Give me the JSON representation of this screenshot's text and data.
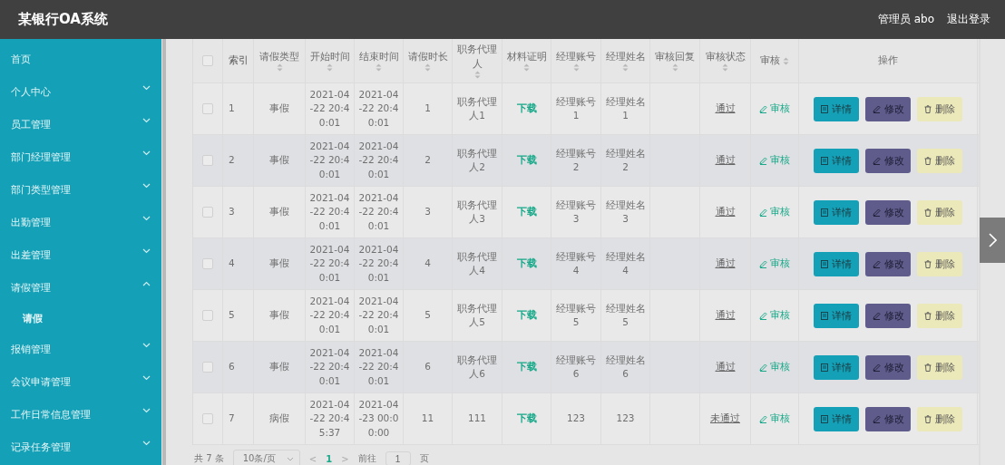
{
  "header": {
    "title": "某银行OA系统",
    "user": "管理员 abo",
    "logout": "退出登录"
  },
  "sidebar": {
    "items": [
      {
        "label": "首页"
      },
      {
        "label": "个人中心",
        "expanded": false
      },
      {
        "label": "员工管理",
        "expanded": false
      },
      {
        "label": "部门经理管理",
        "expanded": false
      },
      {
        "label": "部门类型管理",
        "expanded": false
      },
      {
        "label": "出勤管理",
        "expanded": false
      },
      {
        "label": "出差管理",
        "expanded": false
      },
      {
        "label": "请假管理",
        "expanded": true,
        "children": [
          {
            "label": "请假"
          }
        ]
      },
      {
        "label": "报销管理",
        "expanded": false
      },
      {
        "label": "会议申请管理",
        "expanded": false
      },
      {
        "label": "工作日常信息管理",
        "expanded": false
      },
      {
        "label": "记录任务管理",
        "expanded": false
      }
    ]
  },
  "table": {
    "select_all_checked": false,
    "columns": [
      {
        "label": "索引",
        "sortable": false
      },
      {
        "label": "请假类型",
        "sortable": true
      },
      {
        "label": "开始时间",
        "sortable": true
      },
      {
        "label": "结束时间",
        "sortable": true
      },
      {
        "label": "请假时长",
        "sortable": true
      },
      {
        "label": "职务代理人",
        "sortable": true
      },
      {
        "label": "材料证明",
        "sortable": true
      },
      {
        "label": "经理账号",
        "sortable": true
      },
      {
        "label": "经理姓名",
        "sortable": true
      },
      {
        "label": "审核回复",
        "sortable": true
      },
      {
        "label": "审核状态",
        "sortable": true
      },
      {
        "label": "审核",
        "sortable": true
      },
      {
        "label": "操作",
        "sortable": false
      }
    ],
    "rows": [
      {
        "checked": false,
        "cells": [
          "1",
          "事假",
          "2021-04-22 20:40:01",
          "2021-04-22 20:40:01",
          "1",
          "职务代理人1",
          "下载",
          "经理账号1",
          "经理姓名1",
          "",
          "通过",
          "审核"
        ],
        "actions": [
          "详情",
          "修改",
          "删除"
        ]
      },
      {
        "checked": false,
        "cells": [
          "2",
          "事假",
          "2021-04-22 20:40:01",
          "2021-04-22 20:40:01",
          "2",
          "职务代理人2",
          "下载",
          "经理账号2",
          "经理姓名2",
          "",
          "通过",
          "审核"
        ],
        "actions": [
          "详情",
          "修改",
          "删除"
        ]
      },
      {
        "checked": false,
        "cells": [
          "3",
          "事假",
          "2021-04-22 20:40:01",
          "2021-04-22 20:40:01",
          "3",
          "职务代理人3",
          "下载",
          "经理账号3",
          "经理姓名3",
          "",
          "通过",
          "审核"
        ],
        "actions": [
          "详情",
          "修改",
          "删除"
        ]
      },
      {
        "checked": false,
        "cells": [
          "4",
          "事假",
          "2021-04-22 20:40:01",
          "2021-04-22 20:40:01",
          "4",
          "职务代理人4",
          "下载",
          "经理账号4",
          "经理姓名4",
          "",
          "通过",
          "审核"
        ],
        "actions": [
          "详情",
          "修改",
          "删除"
        ]
      },
      {
        "checked": false,
        "cells": [
          "5",
          "事假",
          "2021-04-22 20:40:01",
          "2021-04-22 20:40:01",
          "5",
          "职务代理人5",
          "下载",
          "经理账号5",
          "经理姓名5",
          "",
          "通过",
          "审核"
        ],
        "actions": [
          "详情",
          "修改",
          "删除"
        ]
      },
      {
        "checked": false,
        "cells": [
          "6",
          "事假",
          "2021-04-22 20:40:01",
          "2021-04-22 20:40:01",
          "6",
          "职务代理人6",
          "下载",
          "经理账号6",
          "经理姓名6",
          "",
          "通过",
          "审核"
        ],
        "actions": [
          "详情",
          "修改",
          "删除"
        ]
      },
      {
        "checked": false,
        "cells": [
          "7",
          "病假",
          "2021-04-22 20:45:37",
          "2021-04-23 00:00:00",
          "11",
          "111",
          "下载",
          "123",
          "123",
          "",
          "未通过",
          "审核"
        ],
        "actions": [
          "详情",
          "修改",
          "删除"
        ]
      }
    ]
  },
  "pagination": {
    "total": "共 7 条",
    "page_size": "10条/页",
    "prev": "<",
    "pages": [
      {
        "label": "1",
        "selected": true
      }
    ],
    "next": ">",
    "goto": "前往",
    "goto_value": "1",
    "page_unit": "页"
  }
}
